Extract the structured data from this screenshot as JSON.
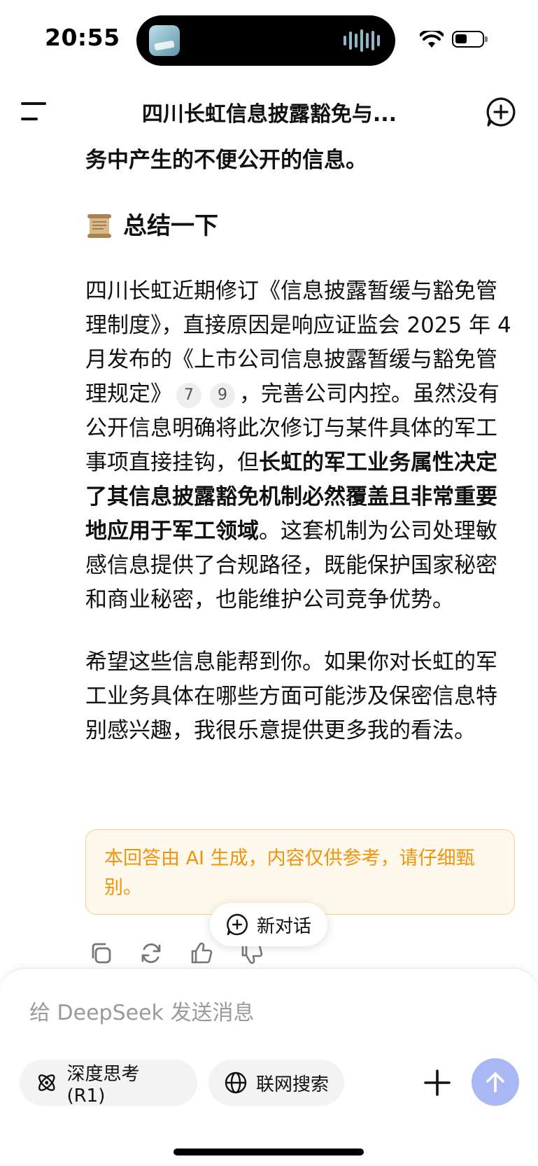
{
  "status_bar": {
    "time": "20:55"
  },
  "header": {
    "title": "四川长虹信息披露豁免与..."
  },
  "message": {
    "intro_line": "务中产生的不便公开的信息。",
    "heading": "总结一下",
    "p1": {
      "part1": "四川长虹近期修订《信息披露暂缓与豁免管理制度》，直接原因是响应证监会 2025 年 4 月发布的《上市公司信息披露暂缓与豁免管理规定》",
      "cite1": "7",
      "cite2": "9",
      "part2": "，完善公司内控。虽然没有公开信息明确将此次修订与某件具体的军工事项直接挂钩，但",
      "bold": "长虹的军工业务属性决定了其信息披露豁免机制必然覆盖且非常重要地应用于军工领域",
      "part3": "。这套机制为公司处理敏感信息提供了合规路径，既能保护国家秘密和商业秘密，也能维护公司竞争优势。"
    },
    "p2": "希望这些信息能帮到你。如果你对长虹的军工业务具体在哪些方面可能涉及保密信息特别感兴趣，我很乐意提供更多我的看法。",
    "notice": "本回答由 AI 生成，内容仅供参考，请仔细甄别。"
  },
  "new_chat_label": "新对话",
  "composer": {
    "placeholder": "给 DeepSeek 发送消息",
    "deep_think_label": "深度思考 (R1)",
    "web_search_label": "联网搜索"
  },
  "icons": {
    "menu": "menu-icon",
    "new_chat": "new-chat-icon",
    "copy": "copy-icon",
    "regenerate": "refresh-icon",
    "like": "thumbs-up-icon",
    "dislike": "thumbs-down-icon",
    "deep_think": "atom-icon",
    "web_search": "globe-icon",
    "attach": "plus-icon",
    "send": "arrow-up-icon"
  },
  "colors": {
    "notice_text": "#f0940d",
    "notice_bg": "#fff8ec",
    "send_button": "#a9b8f5"
  }
}
